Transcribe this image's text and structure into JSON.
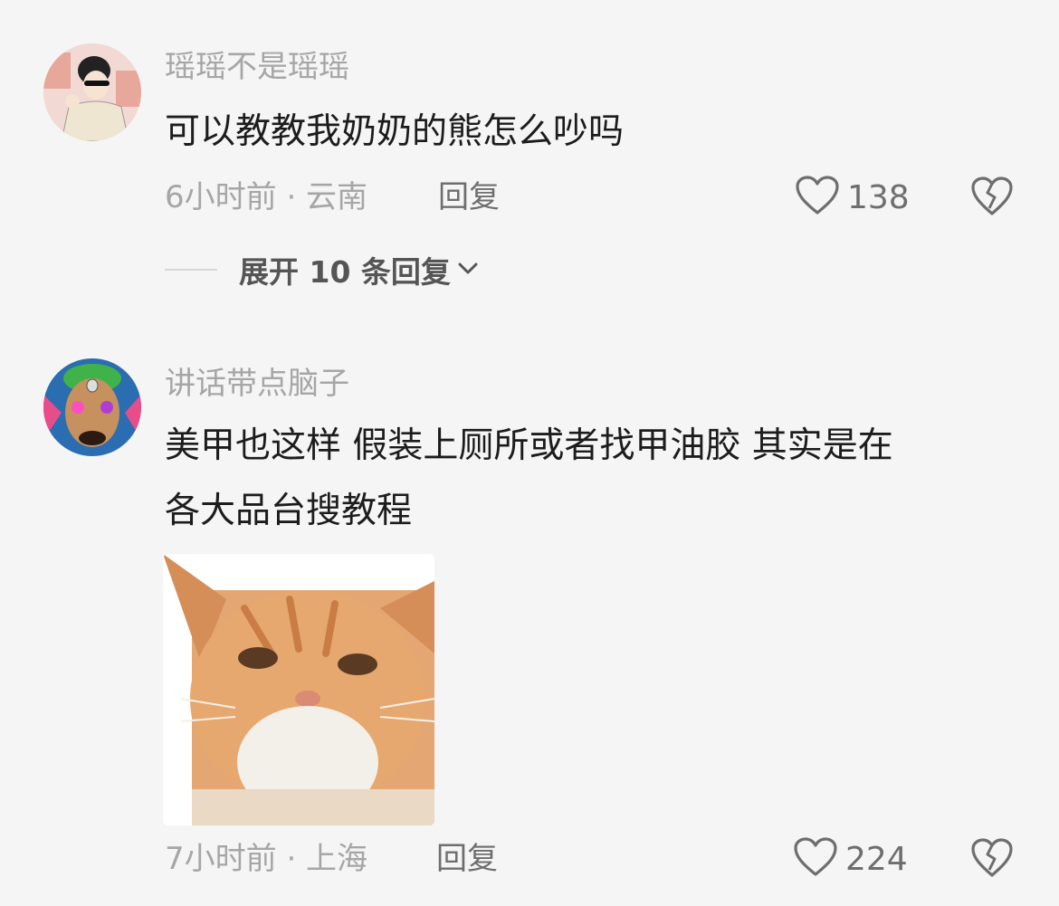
{
  "comments": [
    {
      "username": "瑶瑶不是瑶瑶",
      "text": "可以教教我奶奶的熊怎么吵吗",
      "meta": "6小时前 · 云南",
      "reply_label": "回复",
      "likes": "138",
      "expand_label": "展开 10 条回复"
    },
    {
      "username": "讲话带点脑子",
      "text_line1": "美甲也这样 假装上厕所或者找甲油胶 其实是在",
      "text_line2": "各大品台搜教程",
      "meta": "7小时前 · 上海",
      "reply_label": "回复",
      "likes": "224"
    }
  ],
  "icons": {
    "like": "heart-outline-icon",
    "dislike": "broken-heart-icon",
    "expand": "chevron-down-icon"
  },
  "colors": {
    "background": "#f5f5f5",
    "text": "#1c1c1c",
    "secondary": "#a6a6a6",
    "action": "#6e6e6e"
  }
}
